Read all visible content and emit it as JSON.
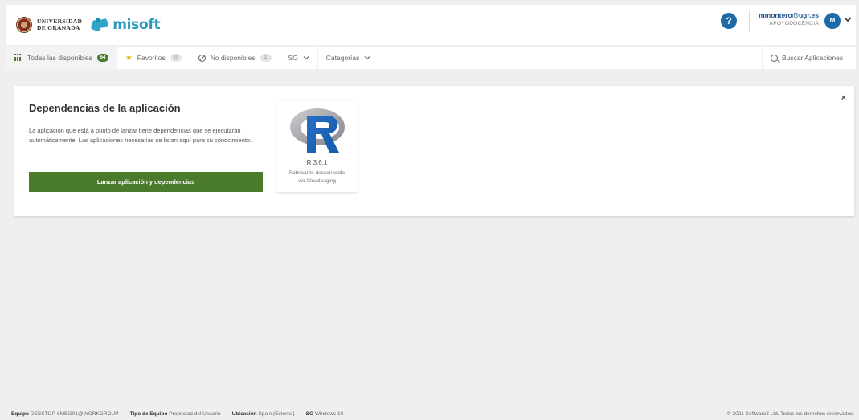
{
  "header": {
    "university_line1": "UNIVERSIDAD",
    "university_line2": "DE GRANADA",
    "brand": "misoft",
    "help_label": "?",
    "user_email": "mmontero@ugr.es",
    "user_role": "APOYODOCENCIA",
    "avatar_initial": "M"
  },
  "nav": {
    "all_label": "Todas las disponibles",
    "all_count": "64",
    "favorites_label": "Favoritos",
    "favorites_count": "0",
    "unavailable_label": "No disponibles",
    "unavailable_count": "1",
    "os_label": "SO",
    "categories_label": "Categorías",
    "search_label": "Buscar Aplicaciones"
  },
  "dialog": {
    "title": "Dependencias de la aplicación",
    "description": "La aplicación que está a punto de lanzar tiene dependencias que se ejecutarán automáticamente. Las aplicaciones necesarias se listan aquí para su conocimiento.",
    "launch_button": "Lanzar aplicación y dependencias",
    "close_label": "×",
    "app": {
      "name": "R 3.6.1",
      "vendor": "Fabricante desconocido",
      "delivery": "vía Cloudpaging"
    }
  },
  "footer": {
    "equipo_label": "Equipo",
    "equipo_value": "DESKTOP-6MEI201@WORKGROUP",
    "tipo_label": "Tipo de Equipo",
    "tipo_value": "Propiedad del Usuario",
    "ubicacion_label": "Ubicación",
    "ubicacion_value": "Spain (Externa)",
    "so_label": "SO",
    "so_value": "Windows 10",
    "copyright": "© 2021 Software2 Ltd. Todos los derechos reservados."
  },
  "colors": {
    "accent_green": "#4a7a2c",
    "brand_blue": "#2b9bbd",
    "user_blue": "#1d6aa8"
  }
}
